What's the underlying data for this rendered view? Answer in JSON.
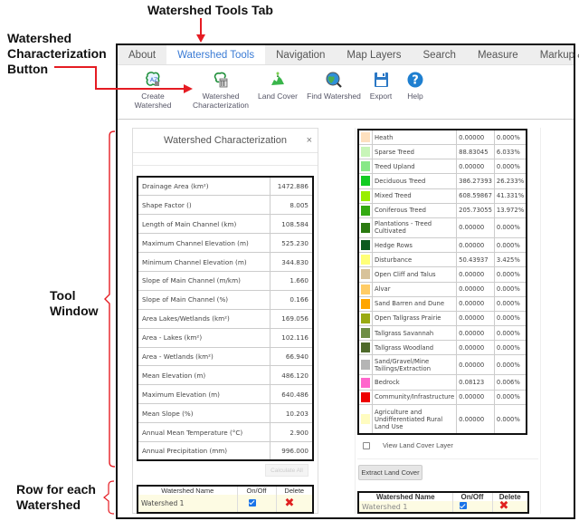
{
  "annotations": {
    "top": "Watershed Tools Tab",
    "button_line1": "Watershed",
    "button_line2": "Characterization",
    "button_line3": "Button",
    "tool_line1": "Tool",
    "tool_line2": "Window",
    "row_line1": "Row for each",
    "row_line2": "Watershed",
    "accent_color": "#e51c23"
  },
  "tabs": [
    {
      "label": "About"
    },
    {
      "label": "Watershed Tools",
      "active": true
    },
    {
      "label": "Navigation"
    },
    {
      "label": "Map Layers"
    },
    {
      "label": "Search"
    },
    {
      "label": "Measure"
    },
    {
      "label": "Markup & Printing"
    }
  ],
  "toolbar": {
    "create_watershed": {
      "line1": "Create",
      "line2": "Watershed",
      "icon": "create-watershed-icon"
    },
    "watershed_characterization": {
      "line1": "Watershed",
      "line2": "Characterization",
      "icon": "characterization-icon"
    },
    "land_cover": {
      "label": "Land Cover",
      "icon": "land-cover-icon"
    },
    "find_watershed": {
      "label": "Find Watershed",
      "icon": "globe-search-icon"
    },
    "export": {
      "label": "Export",
      "icon": "floppy-disk-icon"
    },
    "help": {
      "label": "Help",
      "icon": "help-icon"
    }
  },
  "characterization_panel": {
    "title": "Watershed Characterization",
    "close": "×",
    "rows": [
      {
        "label": "Drainage Area (km²)",
        "value": "1472.886"
      },
      {
        "label": "Shape Factor ()",
        "value": "8.005"
      },
      {
        "label": "Length of Main Channel (km)",
        "value": "108.584"
      },
      {
        "label": "Maximum Channel Elevation (m)",
        "value": "525.230"
      },
      {
        "label": "Minimum Channel Elevation (m)",
        "value": "344.830"
      },
      {
        "label": "Slope of Main Channel (m/km)",
        "value": "1.660"
      },
      {
        "label": "Slope of Main Channel (%)",
        "value": "0.166"
      },
      {
        "label": "Area Lakes/Wetlands (km²)",
        "value": "169.056"
      },
      {
        "label": "Area - Lakes (km²)",
        "value": "102.116"
      },
      {
        "label": "Area - Wetlands (km²)",
        "value": "66.940"
      },
      {
        "label": "Mean Elevation (m)",
        "value": "486.120"
      },
      {
        "label": "Maximum Elevation (m)",
        "value": "640.486"
      },
      {
        "label": "Mean Slope (%)",
        "value": "10.203"
      },
      {
        "label": "Annual Mean Temperature (°C)",
        "value": "2.900"
      },
      {
        "label": "Annual Precipitation (mm)",
        "value": "996.000"
      }
    ],
    "calculate_all": "Calculate All",
    "watershed_table": {
      "headers": [
        "Watershed Name",
        "On/Off",
        "Delete"
      ],
      "rows": [
        {
          "name": "Watershed 1",
          "on": true
        }
      ]
    }
  },
  "land_cover_panel": {
    "rows": [
      {
        "class": "Heath",
        "area": "0.00000",
        "pct": "0.000%",
        "color": "#fde0bf"
      },
      {
        "class": "Sparse Treed",
        "area": "88.83045",
        "pct": "6.033%",
        "color": "#c8f5b8"
      },
      {
        "class": "Treed Upland",
        "area": "0.00000",
        "pct": "0.000%",
        "color": "#88e888"
      },
      {
        "class": "Deciduous Treed",
        "area": "386.27393",
        "pct": "26.233%",
        "color": "#12cc22"
      },
      {
        "class": "Mixed Treed",
        "area": "608.59867",
        "pct": "41.331%",
        "color": "#99ee00"
      },
      {
        "class": "Coniferous Treed",
        "area": "205.73055",
        "pct": "13.972%",
        "color": "#33aa11"
      },
      {
        "class": "Plantations - Treed Cultivated",
        "area": "0.00000",
        "pct": "0.000%",
        "color": "#2a7a10"
      },
      {
        "class": "Hedge Rows",
        "area": "0.00000",
        "pct": "0.000%",
        "color": "#0b5a1e"
      },
      {
        "class": "Disturbance",
        "area": "50.43937",
        "pct": "3.425%",
        "color": "#ffff77"
      },
      {
        "class": "Open Cliff and Talus",
        "area": "0.00000",
        "pct": "0.000%",
        "color": "#d8c39a"
      },
      {
        "class": "Alvar",
        "area": "0.00000",
        "pct": "0.000%",
        "color": "#ffcc66"
      },
      {
        "class": "Sand Barren and Dune",
        "area": "0.00000",
        "pct": "0.000%",
        "color": "#ffa500"
      },
      {
        "class": "Open Tallgrass Prairie",
        "area": "0.00000",
        "pct": "0.000%",
        "color": "#99aa11"
      },
      {
        "class": "Tallgrass Savannah",
        "area": "0.00000",
        "pct": "0.000%",
        "color": "#6e8e44"
      },
      {
        "class": "Tallgrass Woodland",
        "area": "0.00000",
        "pct": "0.000%",
        "color": "#4e6a2a"
      },
      {
        "class": "Sand/Gravel/Mine Tailings/Extraction",
        "area": "0.00000",
        "pct": "0.000%",
        "color": "#b5b5b5"
      },
      {
        "class": "Bedrock",
        "area": "0.08123",
        "pct": "0.006%",
        "color": "#ff66cc"
      },
      {
        "class": "Community/Infrastructure",
        "area": "0.00000",
        "pct": "0.000%",
        "color": "#ee0000"
      },
      {
        "class": "Agriculture and Undifferentiated Rural Land Use",
        "area": "0.00000",
        "pct": "0.000%",
        "color": "#fffcc0"
      }
    ],
    "view_layer_label": "View Land Cover Layer",
    "view_layer_checked": false,
    "extract_button": "Extract Land Cover",
    "watershed_table": {
      "headers": [
        "Watershed Name",
        "On/Off",
        "Delete"
      ],
      "rows": [
        {
          "name": "Watershed 1",
          "on": true
        }
      ]
    }
  }
}
